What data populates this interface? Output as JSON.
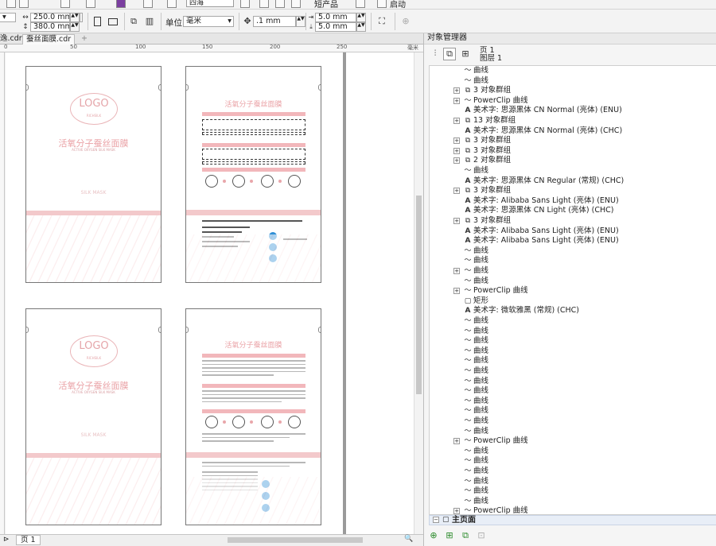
{
  "toolbar_top": {
    "font_select": "四海",
    "auto_label": "短产品",
    "launch_label": "启动"
  },
  "toolbar": {
    "width": "250.0 mm",
    "height": "380.0 mm",
    "unit_label": "单位:",
    "unit_value": "毫米",
    "nudge": ".1 mm",
    "dup_x": "5.0 mm",
    "dup_y": "5.0 mm"
  },
  "tabs": [
    {
      "label": "逸.cdr"
    },
    {
      "label": "蚕丝面膜.cdr"
    }
  ],
  "ruler": {
    "marks": [
      "0",
      "50",
      "100",
      "150",
      "200",
      "250"
    ],
    "unit": "毫米"
  },
  "status": {
    "page_tab": "页 1"
  },
  "design": {
    "logo": "LOGO",
    "logo_sub": "RICHSILK",
    "title": "活氧分子蚕丝面膜",
    "subtitle": "ACTIVE OXYGEN SILK MASK",
    "brand": "SILK MASK",
    "back_title": "活氧分子蚕丝面膜"
  },
  "object_manager": {
    "title": "对象管理器",
    "page_label": "页 1",
    "layer_label": "图层 1",
    "master_label": "主页面",
    "items": [
      {
        "icon": "curve-icon",
        "expand": false,
        "label": "曲线"
      },
      {
        "icon": "curve-icon",
        "expand": false,
        "label": "曲线"
      },
      {
        "icon": "group-icon",
        "expand": true,
        "label": "3 对象群组"
      },
      {
        "icon": "curve-icon",
        "expand": true,
        "label": "PowerClip 曲线"
      },
      {
        "icon": "text-icon",
        "expand": false,
        "label": "美术字: 思源黑体 CN Normal (亮体) (ENU)"
      },
      {
        "icon": "group-icon",
        "expand": true,
        "label": "13 对象群组"
      },
      {
        "icon": "text-icon",
        "expand": false,
        "label": "美术字: 思源黑体 CN Normal (亮体) (CHC)"
      },
      {
        "icon": "group-icon",
        "expand": true,
        "label": "3 对象群组"
      },
      {
        "icon": "group-icon",
        "expand": true,
        "label": "3 对象群组"
      },
      {
        "icon": "group-icon",
        "expand": true,
        "label": "2 对象群组"
      },
      {
        "icon": "curve-icon",
        "expand": false,
        "label": "曲线"
      },
      {
        "icon": "text-icon",
        "expand": false,
        "label": "美术字: 思源黑体 CN Regular (常规) (CHC)"
      },
      {
        "icon": "group-icon",
        "expand": true,
        "label": "3 对象群组"
      },
      {
        "icon": "text-icon",
        "expand": false,
        "label": "美术字: Alibaba Sans Light (亮体) (ENU)"
      },
      {
        "icon": "text-icon",
        "expand": false,
        "label": "美术字: 思源黑体 CN Light (亮体) (CHC)"
      },
      {
        "icon": "group-icon",
        "expand": true,
        "label": "3 对象群组"
      },
      {
        "icon": "text-icon",
        "expand": false,
        "label": "美术字: Alibaba Sans Light (亮体) (ENU)"
      },
      {
        "icon": "text-icon",
        "expand": false,
        "label": "美术字: Alibaba Sans Light (亮体) (ENU)"
      },
      {
        "icon": "curve-icon",
        "expand": false,
        "label": "曲线"
      },
      {
        "icon": "curve-icon",
        "expand": false,
        "label": "曲线"
      },
      {
        "icon": "curve-icon",
        "expand": true,
        "label": "曲线"
      },
      {
        "icon": "curve-icon",
        "expand": false,
        "label": "曲线"
      },
      {
        "icon": "curve-icon",
        "expand": true,
        "label": "PowerClip 曲线"
      },
      {
        "icon": "rect-icon",
        "expand": false,
        "label": "矩形"
      },
      {
        "icon": "text-icon",
        "expand": false,
        "label": "美术字: 微软雅黑 (常规) (CHC)"
      },
      {
        "icon": "curve-icon",
        "expand": false,
        "label": "曲线"
      },
      {
        "icon": "curve-icon",
        "expand": false,
        "label": "曲线"
      },
      {
        "icon": "curve-icon",
        "expand": false,
        "label": "曲线"
      },
      {
        "icon": "curve-icon",
        "expand": false,
        "label": "曲线"
      },
      {
        "icon": "curve-icon",
        "expand": false,
        "label": "曲线"
      },
      {
        "icon": "curve-icon",
        "expand": false,
        "label": "曲线"
      },
      {
        "icon": "curve-icon",
        "expand": false,
        "label": "曲线"
      },
      {
        "icon": "curve-icon",
        "expand": false,
        "label": "曲线"
      },
      {
        "icon": "curve-icon",
        "expand": false,
        "label": "曲线"
      },
      {
        "icon": "curve-icon",
        "expand": false,
        "label": "曲线"
      },
      {
        "icon": "curve-icon",
        "expand": false,
        "label": "曲线"
      },
      {
        "icon": "curve-icon",
        "expand": false,
        "label": "曲线"
      },
      {
        "icon": "curve-icon",
        "expand": true,
        "label": "PowerClip 曲线"
      },
      {
        "icon": "curve-icon",
        "expand": false,
        "label": "曲线"
      },
      {
        "icon": "curve-icon",
        "expand": false,
        "label": "曲线"
      },
      {
        "icon": "curve-icon",
        "expand": false,
        "label": "曲线"
      },
      {
        "icon": "curve-icon",
        "expand": false,
        "label": "曲线"
      },
      {
        "icon": "curve-icon",
        "expand": false,
        "label": "曲线"
      },
      {
        "icon": "curve-icon",
        "expand": false,
        "label": "曲线"
      },
      {
        "icon": "curve-icon",
        "expand": true,
        "label": "PowerClip 曲线"
      }
    ]
  }
}
